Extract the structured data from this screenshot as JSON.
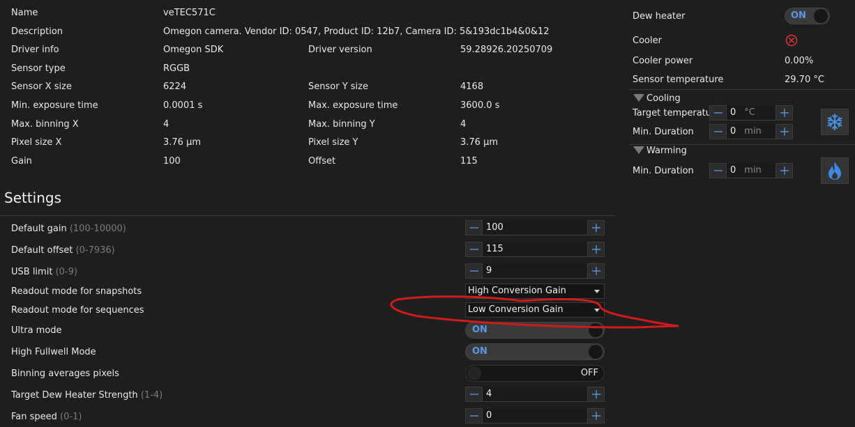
{
  "info": {
    "rows": [
      {
        "label": "Name",
        "value": "veTEC571C"
      },
      {
        "label": "Description",
        "value": "Omegon camera. Vendor ID: 0547, Product ID: 12b7, Camera ID: 5&193dc1b4&0&12"
      },
      {
        "label": "Driver info",
        "value": "Omegon SDK",
        "label2": "Driver version",
        "value2": "59.28926.20250709"
      },
      {
        "label": "Sensor type",
        "value": "RGGB"
      },
      {
        "label": "Sensor X size",
        "value": "6224",
        "label2": "Sensor Y size",
        "value2": "4168"
      },
      {
        "label": "Min. exposure time",
        "value": "0.0001 s",
        "label2": "Max. exposure time",
        "value2": "3600.0 s"
      },
      {
        "label": "Max. binning X",
        "value": "4",
        "label2": "Max. binning Y",
        "value2": "4"
      },
      {
        "label": "Pixel size X",
        "value": "3.76 µm",
        "label2": "Pixel size Y",
        "value2": "3.76 µm"
      },
      {
        "label": "Gain",
        "value": "100",
        "label2": "Offset",
        "value2": "115"
      }
    ]
  },
  "settings": {
    "title": "Settings",
    "default_gain": {
      "label": "Default gain",
      "range": "(100-10000)",
      "value": "100"
    },
    "default_offset": {
      "label": "Default offset",
      "range": "(0-7936)",
      "value": "115"
    },
    "usb_limit": {
      "label": "USB limit",
      "range": "(0-9)",
      "value": "9"
    },
    "readout_snapshots": {
      "label": "Readout mode for snapshots",
      "value": "High Conversion Gain"
    },
    "readout_sequences": {
      "label": "Readout mode for sequences",
      "value": "Low Conversion Gain"
    },
    "ultra_mode": {
      "label": "Ultra mode",
      "state": "ON"
    },
    "high_fullwell": {
      "label": "High Fullwell Mode",
      "state": "ON"
    },
    "binning_avg": {
      "label": "Binning averages pixels",
      "state": "OFF"
    },
    "dew_strength": {
      "label": "Target Dew Heater Strength",
      "range": "(1-4)",
      "value": "4"
    },
    "fan_speed": {
      "label": "Fan speed",
      "range": "(0-1)",
      "value": "0"
    }
  },
  "right": {
    "dew_heater": {
      "label": "Dew heater",
      "state": "ON"
    },
    "cooler": {
      "label": "Cooler"
    },
    "cooler_power": {
      "label": "Cooler power",
      "value": "0.00%"
    },
    "sensor_temp": {
      "label": "Sensor temperature",
      "value": "29.70 °C"
    },
    "cooling": {
      "title": "Cooling",
      "target_temp": {
        "label": "Target temperatur",
        "value": "0",
        "unit": "°C"
      },
      "min_duration": {
        "label": "Min. Duration",
        "value": "0",
        "unit": "min"
      }
    },
    "warming": {
      "title": "Warming",
      "min_duration": {
        "label": "Min. Duration",
        "value": "0",
        "unit": "min"
      }
    }
  },
  "colors": {
    "accent": "#4d8fe0",
    "annotation": "#d11a1a",
    "cooler_off": "#e0333a"
  }
}
